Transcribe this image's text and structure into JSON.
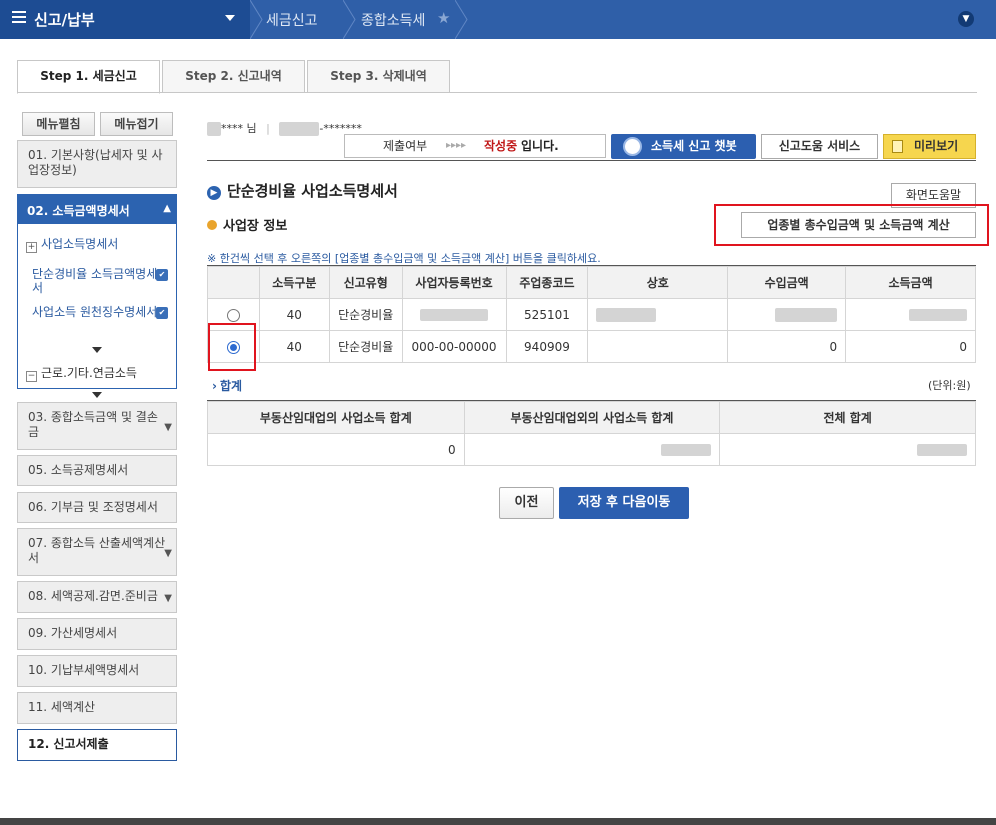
{
  "topbar": {
    "menu_title": "신고/납부",
    "breadcrumb": [
      "세금신고",
      "종합소득세"
    ],
    "colors": {
      "bar": "#2f5fa8",
      "menu": "#1d4c93"
    }
  },
  "tabs": [
    {
      "label": "Step 1. 세금신고",
      "active": true
    },
    {
      "label": "Step 2. 신고내역",
      "active": false
    },
    {
      "label": "Step 3. 삭제내역",
      "active": false
    }
  ],
  "sidebar": {
    "expand_label": "메뉴펼침",
    "collapse_label": "메뉴접기",
    "items_top": [
      "01. 기본사항(납세자 및 사업장정보)"
    ],
    "active": "02. 소득금액명세서",
    "sub_header": "사업소득명세서",
    "sub_items": [
      "단순경비율 소득금액명세서",
      "사업소득 원천징수명세서"
    ],
    "sub_footer": "근로.기타.연금소득",
    "items_bottom": [
      "03. 종합소득금액 및 결손금",
      "05. 소득공제명세서",
      "06. 기부금 및 조정명세서",
      "07. 종합소득 산출세액계산서",
      "08. 세액공제.감면.준비금",
      "09. 가산세명세서",
      "10. 기납부세액명세서",
      "11. 세액계산",
      "12. 신고서제출"
    ]
  },
  "user": {
    "name_suffix": "**** 님",
    "id_masked": "-*******"
  },
  "status": {
    "label": "제출여부",
    "arrows": "▸▸▸▸",
    "state_red": "작성중",
    "state_suffix": "입니다."
  },
  "buttons": {
    "chatbot": "소득세 신고 챗봇",
    "help_service": "신고도움 서비스",
    "preview": "미리보기",
    "screen_help": "화면도움말",
    "calc": "업종별 총수입금액 및 소득금액 계산",
    "prev": "이전",
    "save_next": "저장 후 다음이동"
  },
  "section": {
    "title": "단순경비율 사업소득명세서",
    "subtitle": "사업장 정보",
    "hint": "※ 한건씩 선택 후 오른쪽의 [업종별 총수입금액 및 소득금액 계산] 버튼을 클릭하세요."
  },
  "table": {
    "headers": [
      "소득구분",
      "신고유형",
      "사업자등록번호",
      "주업종코드",
      "상호",
      "수입금액",
      "소득금액"
    ],
    "rows": [
      {
        "selected": false,
        "cells": [
          "40",
          "단순경비율",
          "",
          "525101",
          "",
          "",
          ""
        ]
      },
      {
        "selected": true,
        "cells": [
          "40",
          "단순경비율",
          "000-00-00000",
          "940909",
          "",
          "0",
          "0"
        ]
      }
    ]
  },
  "summary": {
    "label": "합계",
    "unit": "(단위:원)",
    "headers": [
      "부동산임대업의 사업소득 합계",
      "부동산임대업외의 사업소득 합계",
      "전체 합계"
    ],
    "values": [
      "0",
      "",
      ""
    ]
  }
}
